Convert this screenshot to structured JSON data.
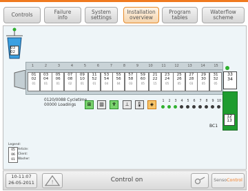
{
  "tabs": [
    {
      "label": "Controls",
      "active": false
    },
    {
      "label": "Failure info",
      "active": false
    },
    {
      "label": "System settings",
      "active": false
    },
    {
      "label": "Installation overview",
      "active": true
    },
    {
      "label": "Program tables",
      "active": false
    },
    {
      "label": "Waterflow scheme",
      "active": false
    }
  ],
  "positions": [
    "1",
    "2",
    "3",
    "4",
    "5",
    "6",
    "7",
    "8",
    "9",
    "10",
    "11",
    "12",
    "13",
    "14",
    "15"
  ],
  "cells": [
    {
      "top": "01",
      "mid": "02",
      "bot": "01"
    },
    {
      "top": "03",
      "mid": "04",
      "bot": "01"
    },
    {
      "top": "05",
      "mid": "06",
      "bot": "01"
    },
    {
      "top": "07",
      "mid": "08",
      "bot": "02"
    },
    {
      "top": "09",
      "mid": "10",
      "bot": "01"
    },
    {
      "top": "11",
      "mid": "52",
      "bot": "01"
    },
    {
      "top": "53",
      "mid": "54",
      "bot": "04"
    },
    {
      "top": "55",
      "mid": "56",
      "bot": "04"
    },
    {
      "top": "57",
      "mid": "58",
      "bot": "03"
    },
    {
      "top": "59",
      "mid": "60",
      "bot": "05"
    },
    {
      "top": "21",
      "mid": "22",
      "bot": "15"
    },
    {
      "top": "23",
      "mid": "24",
      "bot": "05"
    },
    {
      "top": "25",
      "mid": "26",
      "bot": "05"
    },
    {
      "top": "27",
      "mid": "28",
      "bot": "03"
    },
    {
      "top": "29",
      "mid": "30",
      "bot": "05"
    },
    {
      "top": "31",
      "mid": "32",
      "bot": "05"
    }
  ],
  "dryer_cell": {
    "top": "33",
    "bot": "34"
  },
  "buffer": {
    "top": "12",
    "bot": "13"
  },
  "counters": {
    "line1": "0120/0088 Cycletime",
    "line2": "00000 Loadings"
  },
  "tunnel_label": "BC1",
  "dots": {
    "labels": [
      "1",
      "2",
      "3",
      "4",
      "5",
      "6",
      "7",
      "8",
      "9",
      "10"
    ],
    "states": [
      "on",
      "on",
      "on",
      "off",
      "off",
      "off",
      "off",
      "off",
      "off",
      "off"
    ]
  },
  "tool_icons": [
    "valve-icon",
    "tank-icon",
    "dosing-icon",
    "press-icon",
    "temperature-icon",
    "steam-icon"
  ],
  "loader_values": {
    "a": "03",
    "b": "02"
  },
  "legend": {
    "title": "Legend:",
    "box": [
      "05",
      "06",
      "01"
    ],
    "labels": [
      "Article:",
      "Client:",
      "Washer:"
    ]
  },
  "footer": {
    "time": "10-11:07",
    "date": "26-05-2011",
    "status": "Control on",
    "brand_text": "Senso",
    "brand_accent": "Control"
  },
  "colors": {
    "accent": "#f07a20",
    "active_green": "#2fb02f",
    "panel": "#eef5f8"
  }
}
